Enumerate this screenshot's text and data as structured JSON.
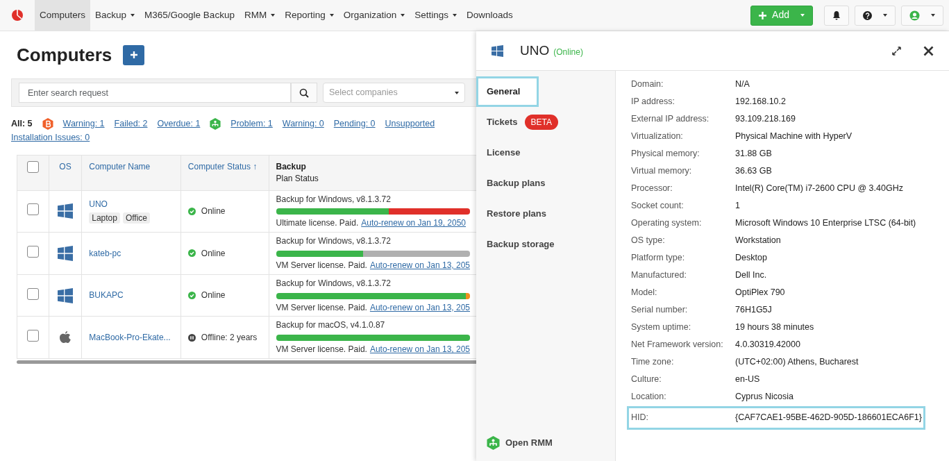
{
  "navbar": {
    "items": [
      {
        "label": "Computers",
        "selected": true,
        "dropdown": false
      },
      {
        "label": "Backup",
        "selected": false,
        "dropdown": true
      },
      {
        "label": "M365/Google Backup",
        "selected": false,
        "dropdown": false
      },
      {
        "label": "RMM",
        "selected": false,
        "dropdown": true
      },
      {
        "label": "Reporting",
        "selected": false,
        "dropdown": true
      },
      {
        "label": "Organization",
        "selected": false,
        "dropdown": true
      },
      {
        "label": "Settings",
        "selected": false,
        "dropdown": true
      },
      {
        "label": "Downloads",
        "selected": false,
        "dropdown": false
      }
    ],
    "add_button": "Add"
  },
  "page": {
    "title": "Computers",
    "search": {
      "placeholder": "Enter search request"
    },
    "company_select": {
      "placeholder": "Select companies"
    },
    "filters": [
      {
        "kind": "text",
        "label": "All: 5"
      },
      {
        "kind": "backup-icon"
      },
      {
        "kind": "link",
        "label": "Warning: 1"
      },
      {
        "kind": "link",
        "label": "Failed: 2"
      },
      {
        "kind": "link",
        "label": "Overdue: 1"
      },
      {
        "kind": "rmm-icon"
      },
      {
        "kind": "link",
        "label": "Problem: 1"
      },
      {
        "kind": "link",
        "label": "Warning: 0"
      },
      {
        "kind": "link",
        "label": "Pending: 0"
      },
      {
        "kind": "link",
        "label": "Unsupported"
      },
      {
        "kind": "link",
        "label": "Installation Issues: 0"
      }
    ],
    "table": {
      "select_all_checked": false,
      "columns": [
        "OS",
        "Computer Name",
        "Computer Status ↑"
      ],
      "backup_column": {
        "title": "Backup",
        "subtitle": "Plan Status"
      },
      "rows": [
        {
          "checked": false,
          "kind": "windows",
          "name": "UNO",
          "tags": [
            "Laptop",
            "Office"
          ],
          "status": "Online",
          "online": true,
          "backup": "Backup for Windows, v8.1.3.72",
          "segments": [
            {
              "color": "#3bb54a",
              "level": 0.58
            },
            {
              "color": "#e0302a",
              "level": 0.42
            }
          ],
          "license": "Ultimate license. Paid.",
          "renew": "Auto-renew on Jan 19, 2050"
        },
        {
          "checked": false,
          "kind": "windows",
          "name": "kateb-pc",
          "tags": [],
          "status": "Online",
          "online": true,
          "backup": "Backup for Windows, v8.1.3.72",
          "segments": [
            {
              "color": "#3bb54a",
              "level": 0.45
            },
            {
              "color": "#b0b0b0",
              "level": 0.55
            }
          ],
          "license": "VM Server license. Paid.",
          "renew": "Auto-renew on Jan 13, 205"
        },
        {
          "checked": false,
          "kind": "windows",
          "name": "BUKAPC",
          "tags": [],
          "status": "Online",
          "online": true,
          "backup": "Backup for Windows, v8.1.3.72",
          "segments": [
            {
              "color": "#3bb54a",
              "level": 0.98
            },
            {
              "color": "#f0901e",
              "level": 0.02
            }
          ],
          "license": "VM Server license. Paid.",
          "renew": "Auto-renew on Jan 13, 205"
        },
        {
          "checked": false,
          "kind": "mac",
          "name": "MacBook-Pro-Ekate...",
          "tags": [],
          "status": "Offline: 2 years",
          "online": false,
          "backup": "Backup for macOS, v4.1.0.87",
          "segments": [
            {
              "color": "#3bb54a",
              "level": 1
            }
          ],
          "license": "VM Server license. Paid.",
          "renew": "Auto-renew on Jan 13, 205"
        }
      ]
    }
  },
  "panel": {
    "title": "UNO",
    "status": "(Online)",
    "tabs": [
      {
        "label": "General",
        "selected": true,
        "highlighted": true
      },
      {
        "label": "Tickets",
        "badge": "BETA",
        "selected": false,
        "highlighted": false
      },
      {
        "label": "License",
        "selected": false,
        "highlighted": false
      },
      {
        "label": "Backup plans",
        "selected": false,
        "highlighted": false
      },
      {
        "label": "Restore plans",
        "selected": false,
        "highlighted": false
      },
      {
        "label": "Backup storage",
        "selected": false,
        "highlighted": false
      }
    ],
    "open_rmm": "Open RMM",
    "details": [
      {
        "label": "Domain:",
        "value": "N/A",
        "highlighted": false
      },
      {
        "label": "IP address:",
        "value": "192.168.10.2",
        "highlighted": false
      },
      {
        "label": "External IP address:",
        "value": "93.109.218.169",
        "highlighted": false
      },
      {
        "label": "Virtualization:",
        "value": "Physical Machine with HyperV",
        "highlighted": false
      },
      {
        "label": "Physical memory:",
        "value": "31.88 GB",
        "highlighted": false
      },
      {
        "label": "Virtual memory:",
        "value": "36.63 GB",
        "highlighted": false
      },
      {
        "label": "Processor:",
        "value": "Intel(R) Core(TM) i7-2600 CPU @ 3.40GHz",
        "highlighted": false
      },
      {
        "label": "Socket count:",
        "value": "1",
        "highlighted": false
      },
      {
        "label": "Operating system:",
        "value": "Microsoft Windows 10 Enterprise LTSC (64-bit)",
        "highlighted": false
      },
      {
        "label": "OS type:",
        "value": "Workstation",
        "highlighted": false
      },
      {
        "label": "Platform type:",
        "value": "Desktop",
        "highlighted": false
      },
      {
        "label": "Manufactured:",
        "value": "Dell Inc.",
        "highlighted": false
      },
      {
        "label": "Model:",
        "value": "OptiPlex 790",
        "highlighted": false
      },
      {
        "label": "Serial number:",
        "value": "76H1G5J",
        "highlighted": false
      },
      {
        "label": "System uptime:",
        "value": "19 hours 38 minutes",
        "highlighted": false
      },
      {
        "label": "Net Framework version:",
        "value": "4.0.30319.42000",
        "highlighted": false
      },
      {
        "label": "Time zone:",
        "value": "(UTC+02:00) Athens, Bucharest",
        "highlighted": false
      },
      {
        "label": "Culture:",
        "value": "en-US",
        "highlighted": false
      },
      {
        "label": "Location:",
        "value": "Cyprus Nicosia",
        "highlighted": false
      },
      {
        "label": "HID:",
        "value": "{CAF7CAE1-95BE-462D-905D-186601ECA6F1}",
        "highlighted": true
      }
    ]
  }
}
